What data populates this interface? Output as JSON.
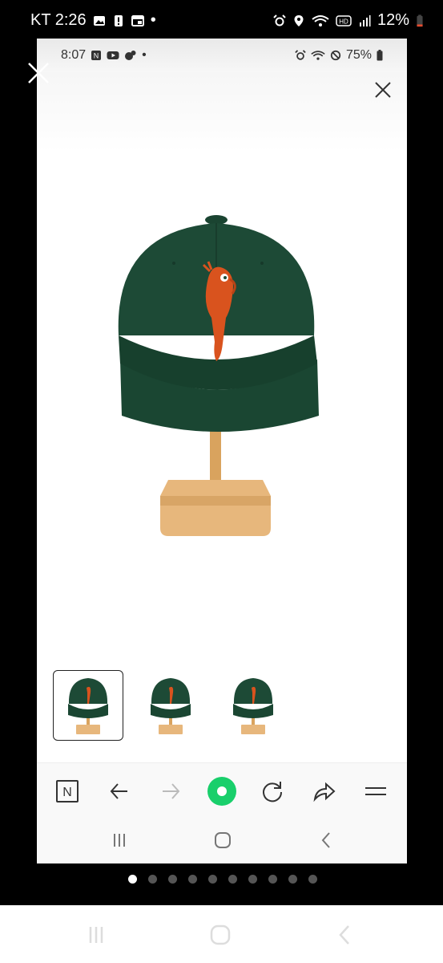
{
  "outer_status": {
    "carrier_time": "KT 2:26",
    "dot": "•",
    "battery": "12%"
  },
  "inner_status": {
    "time": "8:07",
    "dot": "•",
    "battery": "75%"
  },
  "browser_toolbar": {
    "naver_label": "N"
  },
  "colors": {
    "cap_green": "#1d4a36",
    "parrot_orange": "#d9531e",
    "wood": "#e2b27a",
    "reload_green": "#19cf6b"
  },
  "pager": {
    "count": 10,
    "active_index": 0
  }
}
